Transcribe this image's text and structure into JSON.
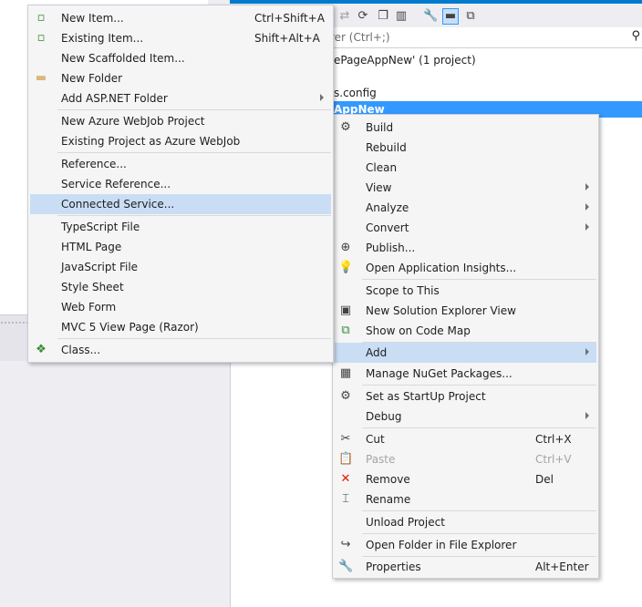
{
  "solution_explorer": {
    "search_placeholder": "rer (Ctrl+;)",
    "tree": [
      {
        "text": "ePageAppNew' (1 project)"
      },
      {
        "text": "s.config"
      }
    ],
    "selected_node": "AppNew"
  },
  "add_submenu": {
    "items": [
      {
        "label": "New Item...",
        "shortcut": "Ctrl+Shift+A",
        "icon": "new-item-icon"
      },
      {
        "label": "Existing Item...",
        "shortcut": "Shift+Alt+A",
        "icon": "existing-item-icon"
      },
      {
        "label": "New Scaffolded Item..."
      },
      {
        "label": "New Folder",
        "icon": "folder-icon"
      },
      {
        "label": "Add ASP.NET Folder",
        "submenu": true
      },
      {
        "label": "New Azure WebJob Project"
      },
      {
        "label": "Existing Project as Azure WebJob"
      },
      {
        "label": "Reference..."
      },
      {
        "label": "Service Reference..."
      },
      {
        "label": "Connected Service...",
        "highlighted": true
      },
      {
        "label": "TypeScript File"
      },
      {
        "label": "HTML Page"
      },
      {
        "label": "JavaScript File"
      },
      {
        "label": "Style Sheet"
      },
      {
        "label": "Web Form"
      },
      {
        "label": "MVC 5 View Page (Razor)"
      },
      {
        "label": "Class...",
        "icon": "class-icon"
      }
    ]
  },
  "context_menu": {
    "items": [
      {
        "label": "Build",
        "icon": "build-icon"
      },
      {
        "label": "Rebuild"
      },
      {
        "label": "Clean"
      },
      {
        "label": "View",
        "submenu": true
      },
      {
        "label": "Analyze",
        "submenu": true
      },
      {
        "label": "Convert",
        "submenu": true
      },
      {
        "label": "Publish...",
        "icon": "publish-icon"
      },
      {
        "label": "Open Application Insights...",
        "icon": "insights-icon"
      },
      {
        "label": "Scope to This"
      },
      {
        "label": "New Solution Explorer View",
        "icon": "solution-view-icon"
      },
      {
        "label": "Show on Code Map",
        "icon": "code-map-icon"
      },
      {
        "label": "Add",
        "submenu": true,
        "highlighted": true
      },
      {
        "label": "Manage NuGet Packages...",
        "icon": "nuget-icon"
      },
      {
        "label": "Set as StartUp Project",
        "icon": "gear-icon"
      },
      {
        "label": "Debug",
        "submenu": true
      },
      {
        "label": "Cut",
        "shortcut": "Ctrl+X",
        "icon": "scissors-icon"
      },
      {
        "label": "Paste",
        "shortcut": "Ctrl+V",
        "icon": "paste-icon",
        "disabled": true
      },
      {
        "label": "Remove",
        "shortcut": "Del",
        "icon": "remove-icon"
      },
      {
        "label": "Rename",
        "icon": "rename-icon"
      },
      {
        "label": "Unload Project"
      },
      {
        "label": "Open Folder in File Explorer",
        "icon": "open-folder-icon"
      },
      {
        "label": "Properties",
        "shortcut": "Alt+Enter",
        "icon": "wrench-icon"
      }
    ]
  },
  "colors": {
    "highlight": "#c9def5",
    "selection": "#3399ff",
    "accent": "#007acc",
    "remove_icon": "#e51400",
    "nuget_icon": "#424242"
  }
}
